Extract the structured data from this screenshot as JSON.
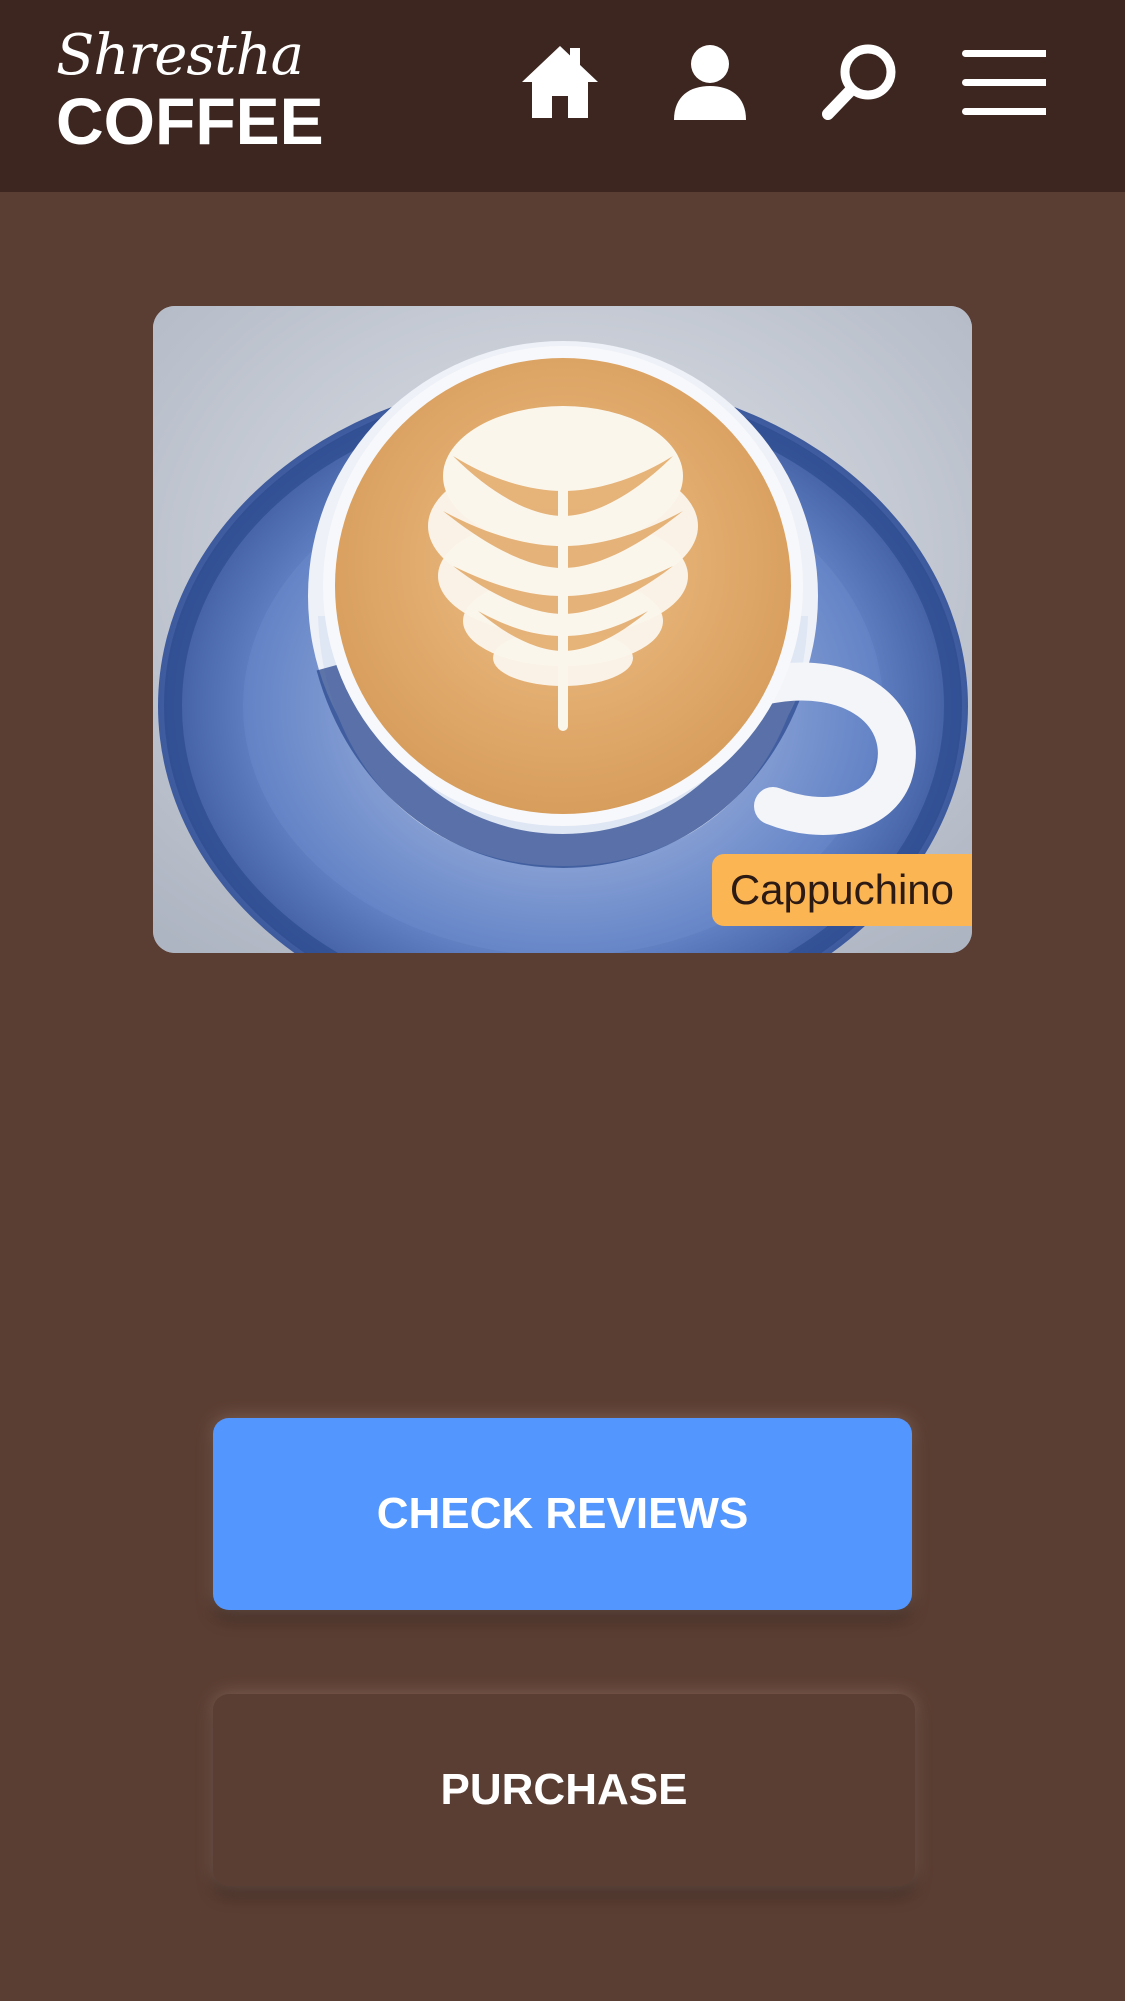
{
  "header": {
    "logo_script": "Shrestha",
    "logo_main": "COFFEE",
    "icons": [
      "home-icon",
      "user-icon",
      "search-icon",
      "menu-icon"
    ]
  },
  "product": {
    "name": "Cappuchino",
    "image": "cappuccino-latte-art-photo"
  },
  "buttons": {
    "check_reviews": "CHECK REVIEWS",
    "purchase": "PURCHASE"
  },
  "colors": {
    "header_bg": "#3d2620",
    "page_bg": "#5b3e33",
    "label_bg": "#fbb552",
    "primary_button": "#5397fe",
    "secondary_button": "#5b3e33",
    "text_light": "#ffffff"
  }
}
